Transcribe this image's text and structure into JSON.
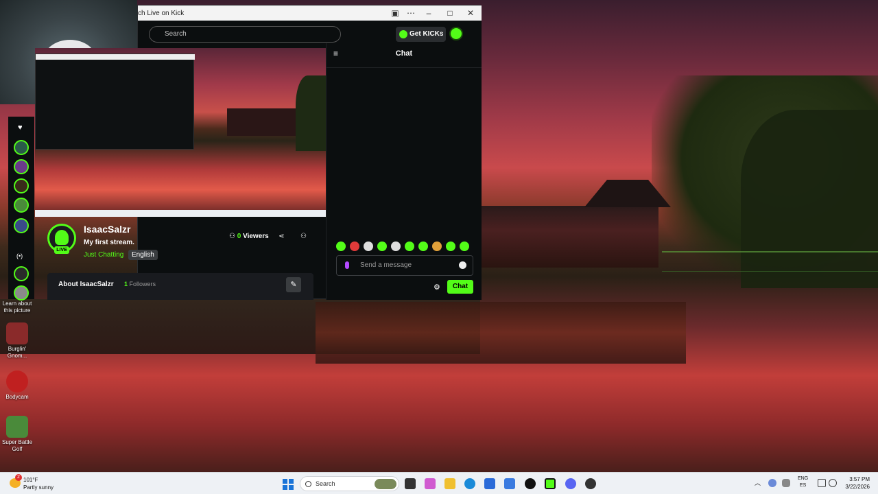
{
  "window": {
    "title": "ch Live on Kick"
  },
  "kick": {
    "search_placeholder": "Search",
    "get_kicks": "Get KICKs",
    "streamer": "IsaacSalzr",
    "stream_title": "My first stream.",
    "category": "Just Chatting",
    "language": "English",
    "live_badge": "LIVE",
    "viewers_count": "0",
    "viewers_label": "Viewers",
    "about_title": "About IsaacSalzr",
    "followers_count": "1",
    "followers_label": "Followers"
  },
  "chat": {
    "title": "Chat",
    "placeholder": "Send a message",
    "send_label": "Chat"
  },
  "desktop": {
    "learn_about": "Learn about this picture",
    "icons": [
      {
        "label": "Burglin' Gnom..."
      },
      {
        "label": "Bodycam"
      },
      {
        "label": "Super Battle Golf"
      }
    ]
  },
  "taskbar": {
    "weather_temp": "101°F",
    "weather_cond": "Partly sunny",
    "search_label": "Search",
    "lang_top": "ENG",
    "lang_bottom": "ES",
    "time": "3:57 PM",
    "date": "3/22/2026"
  },
  "colors": {
    "accent": "#53fc18",
    "window_bg": "#0b0e0f",
    "taskbar_bg": "#eef1f5"
  },
  "icons": [
    "search-icon",
    "chat-collapse-icon",
    "viewers-icon",
    "share-icon",
    "follow-icon",
    "edit-icon",
    "mic-icon",
    "emoji-icon",
    "gear-icon",
    "heart-icon",
    "windows-start-icon"
  ]
}
